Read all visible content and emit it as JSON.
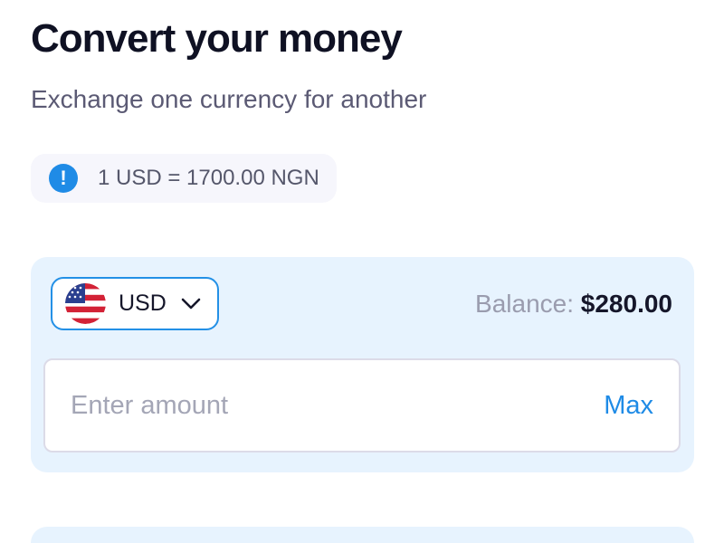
{
  "header": {
    "title": "Convert your money",
    "subtitle": "Exchange one currency for another"
  },
  "rate": {
    "icon": "info-icon",
    "text": "1 USD = 1700.00 NGN"
  },
  "from_card": {
    "currency": {
      "flag_icon": "us-flag-icon",
      "code": "USD"
    },
    "balance_label": "Balance:",
    "balance_value": "$280.00",
    "amount": {
      "value": "",
      "placeholder": "Enter amount"
    },
    "max_label": "Max"
  },
  "colors": {
    "accent": "#1f8be6",
    "card_bg": "#e7f3fe",
    "text_dark": "#0f1123"
  }
}
